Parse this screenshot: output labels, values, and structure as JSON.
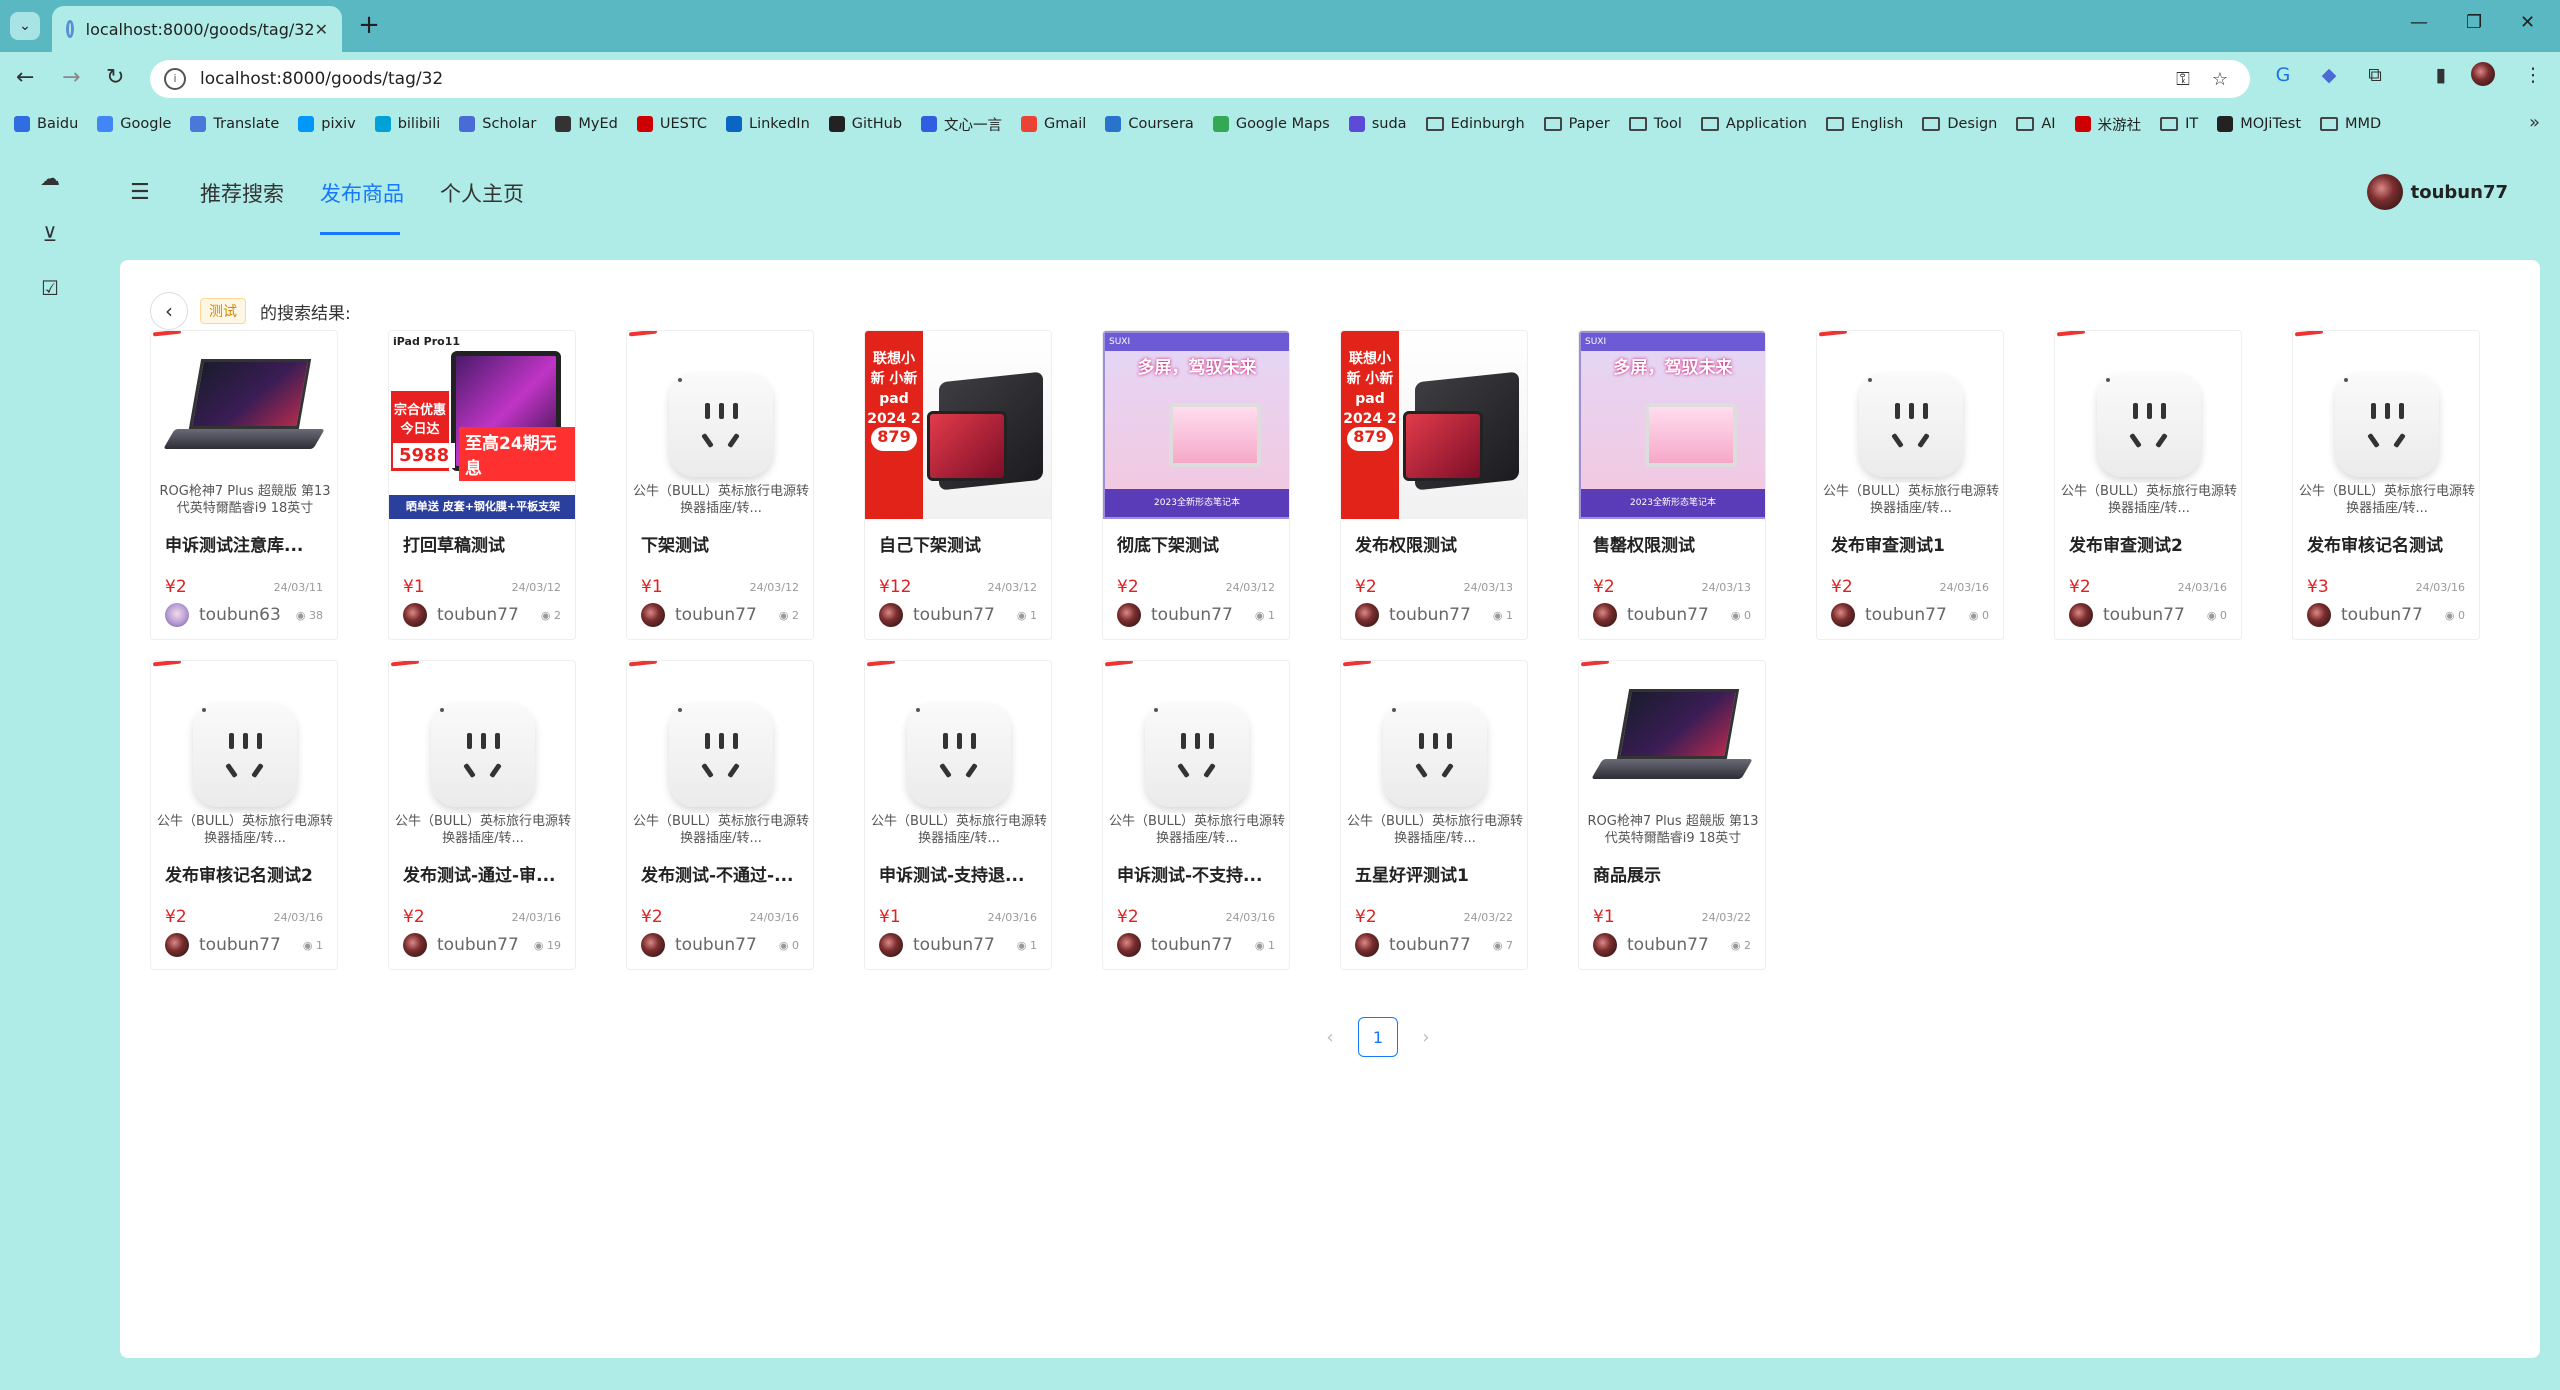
{
  "browser": {
    "tab_title": "localhost:8000/goods/tag/32",
    "url": "localhost:8000/goods/tag/32",
    "bookmarks": [
      "Baidu",
      "Google",
      "Translate",
      "pixiv",
      "bilibili",
      "Scholar",
      "MyEd",
      "UESTC",
      "LinkedIn",
      "GitHub",
      "文心一言",
      "Gmail",
      "Coursera",
      "Google Maps",
      "suda",
      "Edinburgh",
      "Paper",
      "Tool",
      "Application",
      "English",
      "Design",
      "AI",
      "米游社",
      "IT",
      "MOJiTest",
      "MMD"
    ]
  },
  "header": {
    "tabs": [
      "推荐搜索",
      "发布商品",
      "个人主页"
    ],
    "active_tab": "发布商品",
    "username": "toubun77"
  },
  "search": {
    "keyword": "测试",
    "suffix": "的搜索结果:"
  },
  "products": [
    {
      "image": "laptop",
      "desc": "ROG枪神7 Plus 超競版 第13代英特爾酷睿i9 18英寸",
      "title": "申诉测试注意库...",
      "price": "¥2",
      "date": "24/03/11",
      "user": "toubun63",
      "views": "38"
    },
    {
      "image": "ipad",
      "desc": "",
      "title": "打回草稿测试",
      "price": "¥1",
      "date": "24/03/12",
      "user": "toubun77",
      "views": "2"
    },
    {
      "image": "plug",
      "desc": "公牛（BULL）英标旅行电源转换器插座/转...",
      "title": "下架测试",
      "price": "¥1",
      "date": "24/03/12",
      "user": "toubun77",
      "views": "2"
    },
    {
      "image": "pad",
      "desc": "",
      "title": "自己下架测试",
      "price": "¥12",
      "date": "24/03/12",
      "user": "toubun77",
      "views": "1"
    },
    {
      "image": "suxi",
      "desc": "",
      "title": "彻底下架测试",
      "price": "¥2",
      "date": "24/03/12",
      "user": "toubun77",
      "views": "1"
    },
    {
      "image": "pad",
      "desc": "",
      "title": "发布权限测试",
      "price": "¥2",
      "date": "24/03/13",
      "user": "toubun77",
      "views": "1"
    },
    {
      "image": "suxi",
      "desc": "",
      "title": "售罄权限测试",
      "price": "¥2",
      "date": "24/03/13",
      "user": "toubun77",
      "views": "0"
    },
    {
      "image": "plug",
      "desc": "公牛（BULL）英标旅行电源转换器插座/转...",
      "title": "发布审查测试1",
      "price": "¥2",
      "date": "24/03/16",
      "user": "toubun77",
      "views": "0"
    },
    {
      "image": "plug",
      "desc": "公牛（BULL）英标旅行电源转换器插座/转...",
      "title": "发布审查测试2",
      "price": "¥2",
      "date": "24/03/16",
      "user": "toubun77",
      "views": "0"
    },
    {
      "image": "plug",
      "desc": "公牛（BULL）英标旅行电源转换器插座/转...",
      "title": "发布审核记名测试",
      "price": "¥3",
      "date": "24/03/16",
      "user": "toubun77",
      "views": "0"
    },
    {
      "image": "plug",
      "desc": "公牛（BULL）英标旅行电源转换器插座/转...",
      "title": "发布审核记名测试2",
      "price": "¥2",
      "date": "24/03/16",
      "user": "toubun77",
      "views": "1"
    },
    {
      "image": "plug",
      "desc": "公牛（BULL）英标旅行电源转换器插座/转...",
      "title": "发布测试-通过-审...",
      "price": "¥2",
      "date": "24/03/16",
      "user": "toubun77",
      "views": "19"
    },
    {
      "image": "plug",
      "desc": "公牛（BULL）英标旅行电源转换器插座/转...",
      "title": "发布测试-不通过-...",
      "price": "¥2",
      "date": "24/03/16",
      "user": "toubun77",
      "views": "0"
    },
    {
      "image": "plug",
      "desc": "公牛（BULL）英标旅行电源转换器插座/转...",
      "title": "申诉测试-支持退...",
      "price": "¥1",
      "date": "24/03/16",
      "user": "toubun77",
      "views": "1"
    },
    {
      "image": "plug",
      "desc": "公牛（BULL）英标旅行电源转换器插座/转...",
      "title": "申诉测试-不支持...",
      "price": "¥2",
      "date": "24/03/16",
      "user": "toubun77",
      "views": "1"
    },
    {
      "image": "plug",
      "desc": "公牛（BULL）英标旅行电源转换器插座/转...",
      "title": "五星好评测试1",
      "price": "¥2",
      "date": "24/03/22",
      "user": "toubun77",
      "views": "7"
    },
    {
      "image": "laptop",
      "desc": "ROG枪神7 Plus 超競版 第13代英特爾酷睿i9 18英寸",
      "title": "商品展示",
      "price": "¥1",
      "date": "24/03/22",
      "user": "toubun77",
      "views": "2"
    }
  ],
  "image_text": {
    "ipad_title": "iPad Pro11",
    "ipad_sale": "宗合优惠 今日达",
    "ipad_promo": "至高24期无息",
    "ipad_price": "5988",
    "ipad_bottom": "晒单送 皮套+钢化膜+平板支架",
    "pad_label": "联想小新 小新pad 2024 2年质保",
    "pad_price": "879",
    "suxi_brand": "SUXI",
    "suxi_headline": "多屏，驾驭未来",
    "suxi_bottom": "2023全新形态笔记本"
  },
  "pagination": {
    "current": "1"
  }
}
